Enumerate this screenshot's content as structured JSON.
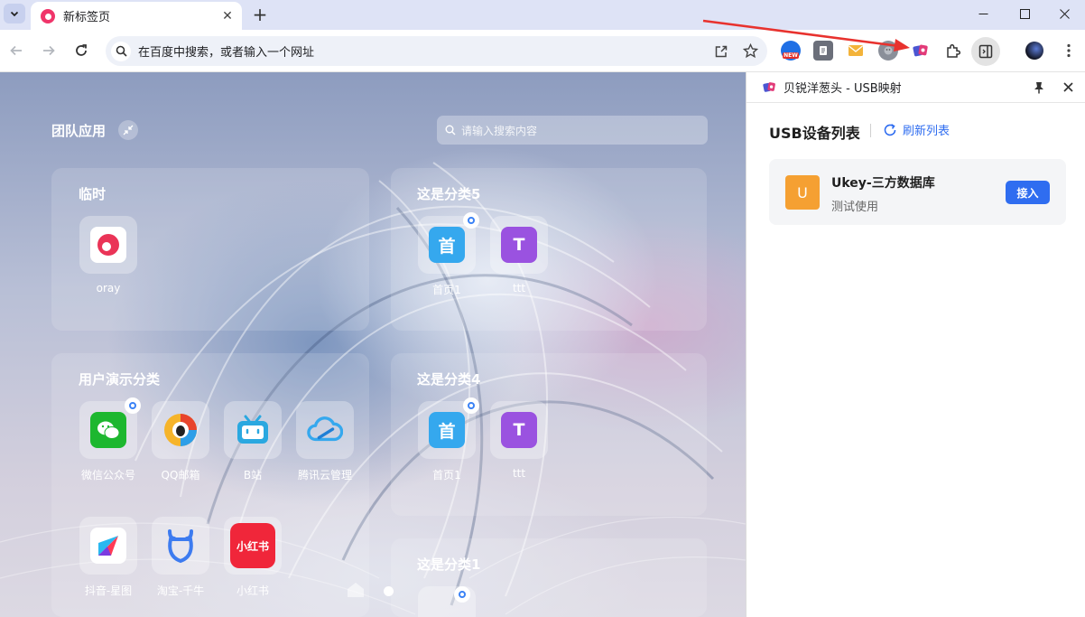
{
  "browser": {
    "tab": {
      "title": "新标签页"
    },
    "omnibox": {
      "placeholder": "在百度中搜索，或者输入一个网址"
    },
    "extensions": [
      {
        "name": "new-badge-extension",
        "label": "NEW",
        "color": "#1f6fe5"
      },
      {
        "name": "doc-extension",
        "color": "#6b6f7a"
      },
      {
        "name": "mail-extension",
        "color": "#f3b33a"
      },
      {
        "name": "gray-extension",
        "color": "#8a8f99"
      },
      {
        "name": "usb-mapping-extension",
        "color": "#c9366d"
      }
    ],
    "accent_color": "#2f6df0"
  },
  "ntp": {
    "title": "团队应用",
    "search_placeholder": "请输入搜索内容",
    "groups": [
      {
        "title": "临时",
        "apps": [
          {
            "label": "oray",
            "icon": "oray-icon",
            "color": "#ea3457"
          }
        ]
      },
      {
        "title": "这是分类5",
        "apps": [
          {
            "label": "首页1",
            "icon": "home-icon",
            "glyph": "首",
            "color": "#35a8ee",
            "badge": true
          },
          {
            "label": "ttt",
            "icon": "letter-t-icon",
            "glyph": "T",
            "color": "#9a52e0"
          }
        ]
      },
      {
        "title": "用户演示分类",
        "apps": [
          {
            "label": "微信公众号",
            "icon": "wechat-icon",
            "color": "#1db72f",
            "badge": true
          },
          {
            "label": "QQ邮箱",
            "icon": "qq-mail-icon",
            "color": "#ffffff"
          },
          {
            "label": "B站",
            "icon": "bilibili-icon",
            "color": "#2aa8e0"
          },
          {
            "label": "腾讯云管理",
            "icon": "tencent-cloud-icon",
            "color": "#35a8ee"
          },
          {
            "label": "抖音-星图",
            "icon": "douyin-xingtu-icon",
            "color": "#ffffff"
          },
          {
            "label": "淘宝-千牛",
            "icon": "taobao-qianniu-icon",
            "color": "#3d7bf0"
          },
          {
            "label": "小红书",
            "icon": "xiaohongshu-icon",
            "glyph": "小红书",
            "color": "#f0263a"
          }
        ]
      },
      {
        "title": "这是分类4",
        "apps": [
          {
            "label": "首页1",
            "icon": "home-icon",
            "glyph": "首",
            "color": "#35a8ee",
            "badge": true
          },
          {
            "label": "ttt",
            "icon": "letter-t-icon",
            "glyph": "T",
            "color": "#9a52e0"
          }
        ]
      },
      {
        "title": "这是分类1",
        "apps": []
      }
    ]
  },
  "sidepanel": {
    "title": "贝锐洋葱头 - USB映射",
    "list_heading": "USB设备列表",
    "refresh_label": "刷新列表",
    "devices": [
      {
        "avatar": "U",
        "name": "Ukey-三方数据库",
        "desc": "测试使用",
        "action": "接入",
        "avatar_color": "#f5a032"
      }
    ]
  }
}
